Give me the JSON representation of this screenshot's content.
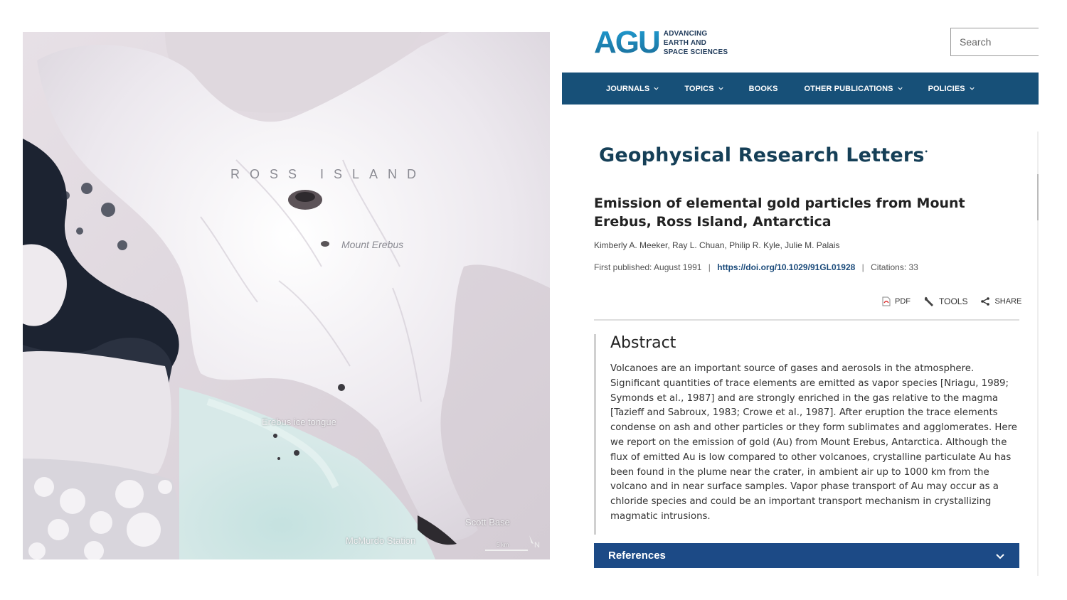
{
  "map": {
    "labels": {
      "island": "ROSS ISLAND",
      "volcano": "Mount Erebus",
      "tongue": "Erebus ice tongue",
      "scott": "Scott Base",
      "mcmurdo": "McMurdo Station",
      "scale": "5 km"
    },
    "icons": {
      "north_arrow": "north-arrow-icon"
    }
  },
  "header": {
    "logo_mark": "AGU",
    "logo_tagline_1": "ADVANCING",
    "logo_tagline_2": "EARTH AND",
    "logo_tagline_3": "SPACE SCIENCES",
    "search_placeholder": "Search"
  },
  "nav": {
    "items": [
      {
        "label": "JOURNALS",
        "dropdown": true
      },
      {
        "label": "TOPICS",
        "dropdown": true
      },
      {
        "label": "BOOKS",
        "dropdown": false
      },
      {
        "label": "OTHER PUBLICATIONS",
        "dropdown": true
      },
      {
        "label": "POLICIES",
        "dropdown": true
      }
    ],
    "color": "#175078"
  },
  "journal": {
    "name": "Geophysical Research Letters",
    "mark": "•"
  },
  "article": {
    "title": "Emission of elemental gold particles from Mount Erebus, Ross Island, Antarctica",
    "authors": "Kimberly A. Meeker, Ray L. Chuan, Philip R. Kyle, Julie M. Palais",
    "published_label": "First published: August 1991",
    "sep": "|",
    "doi": "https://doi.org/10.1029/91GL01928",
    "citations": "Citations: 33"
  },
  "tools": {
    "pdf": "PDF",
    "tools": "TOOLS",
    "share": "SHARE"
  },
  "abstract": {
    "heading": "Abstract",
    "text": "Volcanoes are an important source of gases and aerosols in the atmosphere. Significant quantities of trace elements are emitted as vapor species [Nriagu, 1989; Symonds et al., 1987] and are strongly enriched in the gas relative to the magma [Tazieff and Sabroux, 1983; Crowe et al., 1987]. After eruption the trace elements condense on ash and other particles or they form sublimates and agglomerates. Here we report on the emission of gold (Au) from Mount Erebus, Antarctica. Although the flux of emitted Au is low compared to other volcanoes, crystalline particulate Au has been found in the plume near the crater, in ambient air up to 1000 km from the volcano and in near surface samples. Vapor phase transport of Au may occur as a chloride species and could be an important transport mechanism in crystallizing magmatic intrusions."
  },
  "references": {
    "label": "References",
    "color": "#1c4a86"
  }
}
